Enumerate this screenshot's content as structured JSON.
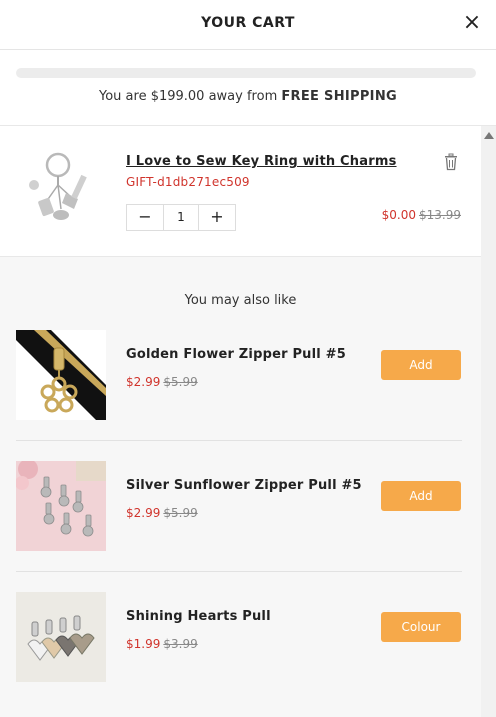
{
  "header": {
    "title": "YOUR CART",
    "close_icon": "close-icon"
  },
  "shipping": {
    "progress_fraction": 0.0,
    "text_prefix": "You are $199.00 away from",
    "text_bold": "FREE SHIPPING"
  },
  "cart_item": {
    "title": "I Love to Sew Key Ring with Charms",
    "sku": "GIFT-d1db271ec509",
    "quantity": "1",
    "minus_label": "−",
    "plus_label": "+",
    "price_now": "$0.00",
    "price_was": "$13.99",
    "trash_icon": "trash-icon"
  },
  "recommendations": {
    "heading": "You may also like",
    "items": [
      {
        "title": "Golden Flower Zipper Pull #5",
        "price_now": "$2.99",
        "price_was": "$5.99",
        "button": "Add"
      },
      {
        "title": "Silver Sunflower Zipper Pull #5",
        "price_now": "$2.99",
        "price_was": "$5.99",
        "button": "Add"
      },
      {
        "title": "Shining Hearts Pull",
        "price_now": "$1.99",
        "price_was": "$3.99",
        "button": "Colour"
      }
    ]
  },
  "colors": {
    "accent": "#f6a94a",
    "sale": "#d0342c"
  }
}
